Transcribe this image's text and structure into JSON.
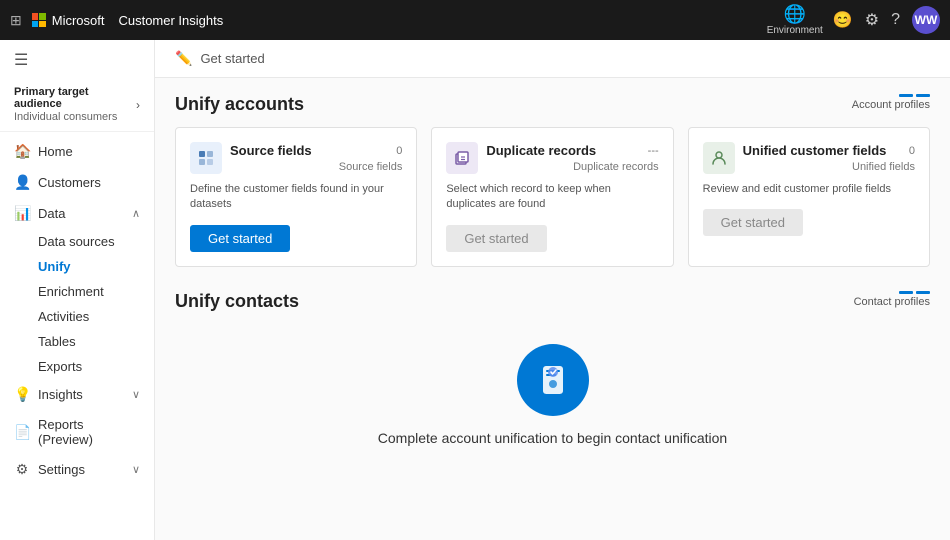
{
  "topbar": {
    "brand": "Microsoft",
    "app_name": "Customer Insights",
    "env_label": "Environment",
    "avatar_initials": "WW"
  },
  "sidebar": {
    "audience_label": "Primary target audience",
    "audience_sub": "Individual consumers",
    "nav_items": [
      {
        "id": "home",
        "label": "Home",
        "icon": "🏠",
        "expandable": false
      },
      {
        "id": "customers",
        "label": "Customers",
        "icon": "👥",
        "expandable": false
      },
      {
        "id": "data",
        "label": "Data",
        "icon": "📊",
        "expandable": true,
        "expanded": true
      },
      {
        "id": "data-sources",
        "label": "Data sources",
        "sub": true
      },
      {
        "id": "unify",
        "label": "Unify",
        "sub": true,
        "active": true
      },
      {
        "id": "enrichment",
        "label": "Enrichment",
        "sub": true
      },
      {
        "id": "activities",
        "label": "Activities",
        "sub": true
      },
      {
        "id": "tables",
        "label": "Tables",
        "sub": true
      },
      {
        "id": "exports",
        "label": "Exports",
        "sub": true
      },
      {
        "id": "insights",
        "label": "Insights",
        "icon": "💡",
        "expandable": true
      },
      {
        "id": "reports",
        "label": "Reports (Preview)",
        "icon": "📄"
      },
      {
        "id": "settings",
        "label": "Settings",
        "icon": "⚙️",
        "expandable": true
      }
    ]
  },
  "main": {
    "header": {
      "icon": "✏️",
      "title": "Get started"
    },
    "section1": {
      "title": "Unify accounts",
      "badge_label": "Account profiles"
    },
    "cards": [
      {
        "id": "source-fields",
        "title": "Source fields",
        "icon_type": "blue-light",
        "icon": "⊞",
        "count": "0",
        "count_label": "Source fields",
        "description": "Define the customer fields found in your datasets",
        "btn_label": "Get started",
        "btn_type": "primary"
      },
      {
        "id": "duplicate-records",
        "title": "Duplicate records",
        "icon_type": "purple-light",
        "icon": "⧉",
        "count": "---",
        "count_label": "Duplicate records",
        "description": "Select which record to keep when duplicates are found",
        "btn_label": "Get started",
        "btn_type": "secondary"
      },
      {
        "id": "unified-customer-fields",
        "title": "Unified customer fields",
        "icon_type": "green-light",
        "icon": "⚇",
        "count": "0",
        "count_label": "Unified fields",
        "description": "Review and edit customer profile fields",
        "btn_label": "Get started",
        "btn_type": "secondary"
      }
    ],
    "section2": {
      "title": "Unify contacts",
      "badge_label": "Contact profiles",
      "message": "Complete account unification to begin contact unification"
    }
  }
}
